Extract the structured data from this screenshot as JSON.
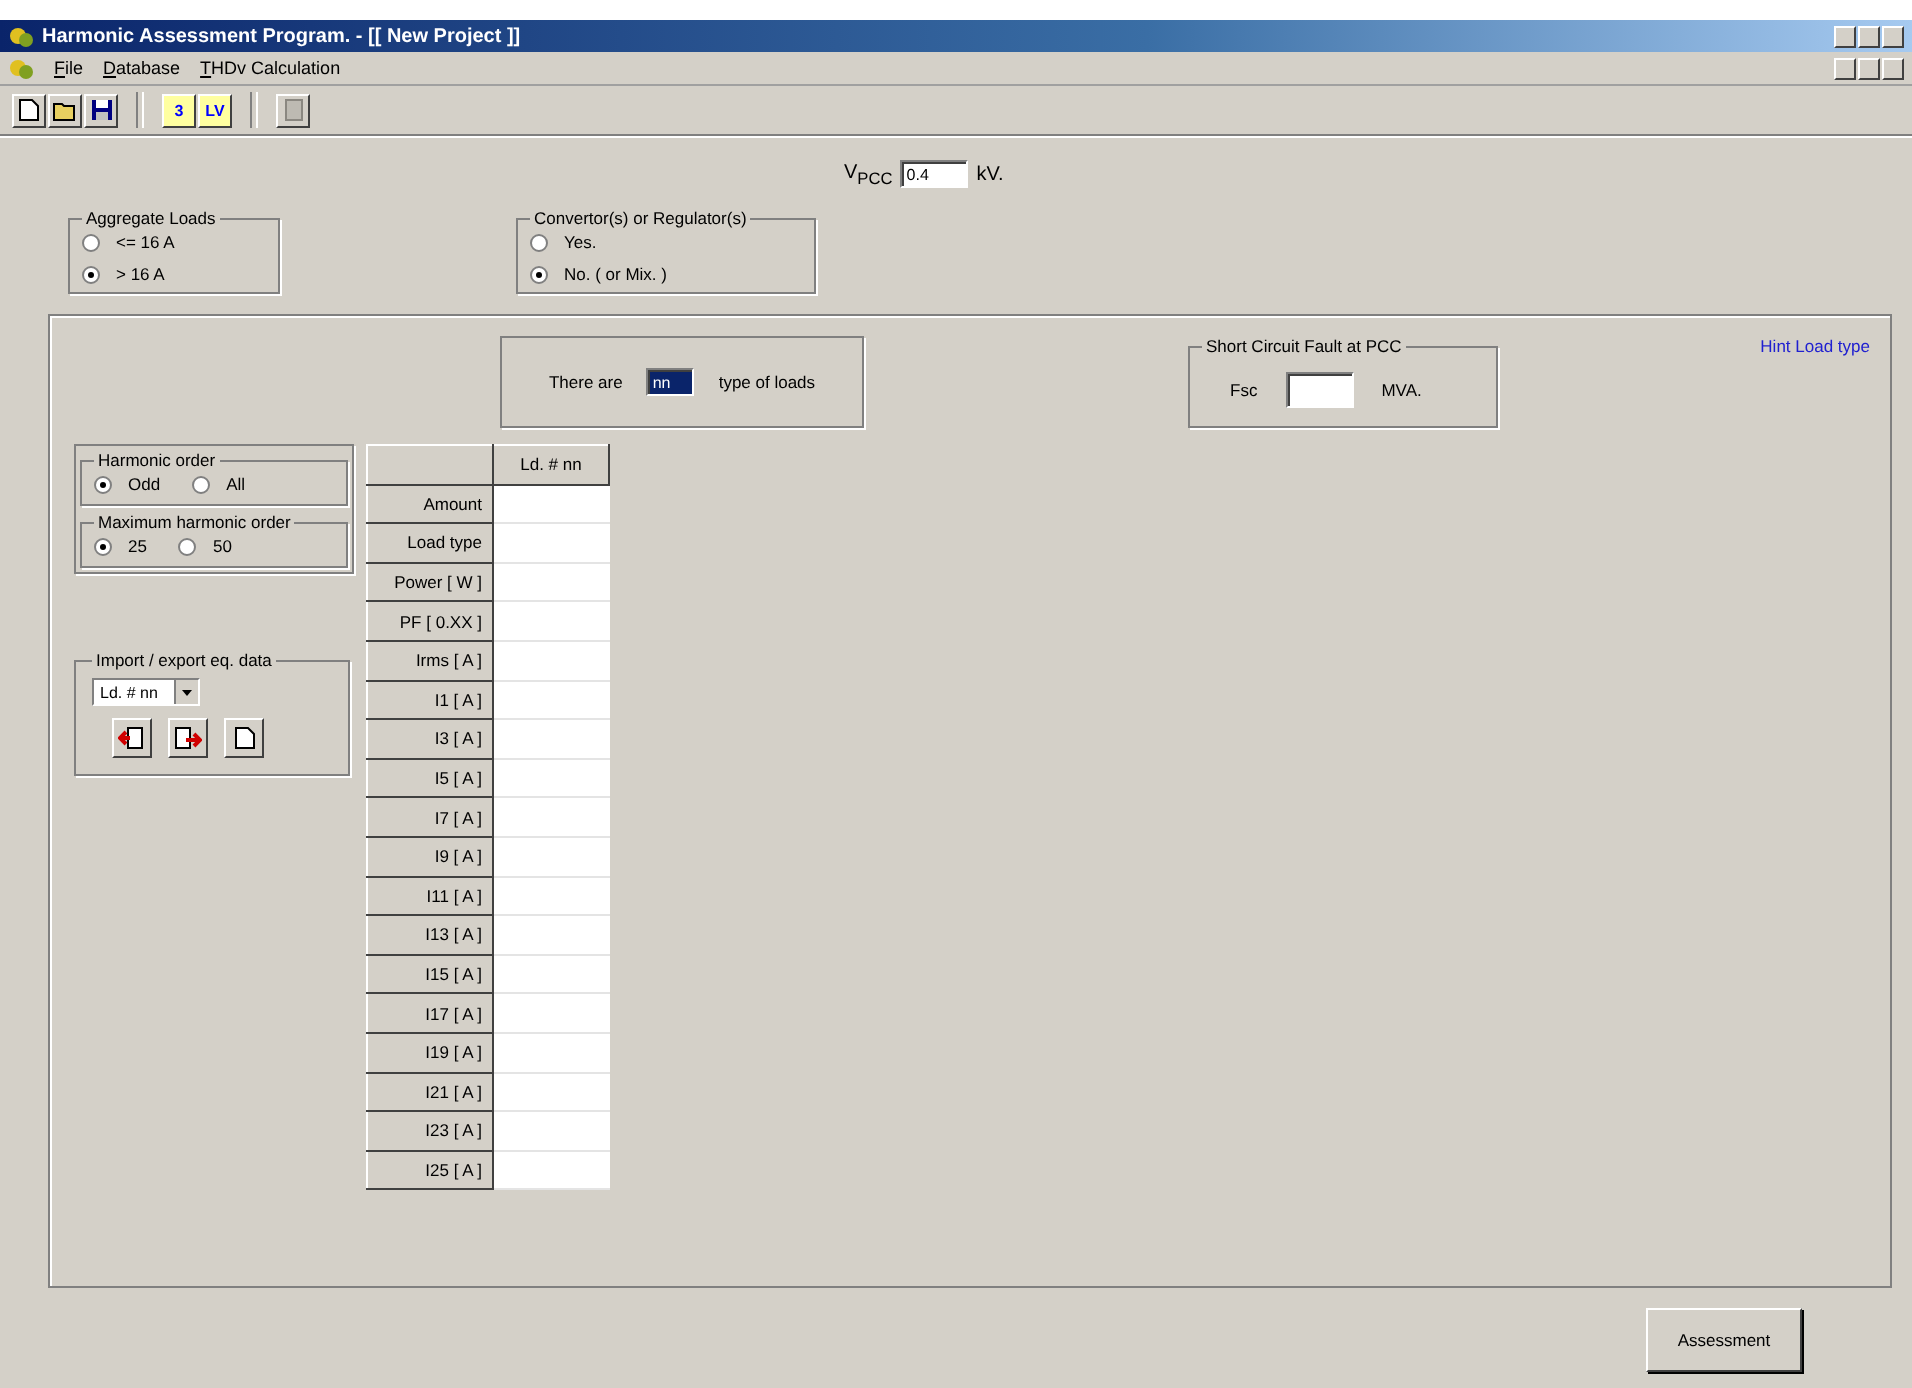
{
  "window": {
    "title": "Harmonic Assessment Program. - [[ New Project ]]"
  },
  "menu": [
    "File",
    "Database",
    "THDv Calculation"
  ],
  "toolbar": [
    {
      "kind": "new"
    },
    {
      "kind": "open"
    },
    {
      "kind": "save"
    },
    {
      "kind": "sep"
    },
    {
      "kind": "text",
      "label": "3"
    },
    {
      "kind": "text",
      "label": "LV"
    },
    {
      "kind": "sep"
    },
    {
      "kind": "print",
      "disabled": true
    }
  ],
  "vpcc": {
    "label": "V$_{PCC}$",
    "value": "0.4",
    "unit": "kV."
  },
  "aggregate_loads": {
    "title": "Aggregate Loads",
    "options": [
      {
        "label": "<= 16 A",
        "selected": false
      },
      {
        "label": "> 16 A",
        "selected": true
      }
    ]
  },
  "converters": {
    "title": "Convertor(s) or Regulator(s)",
    "options": [
      {
        "label": "Yes.",
        "selected": false
      },
      {
        "label": "No. ( or Mix. )",
        "selected": true
      }
    ]
  },
  "load_count": {
    "prefix": "There are",
    "value": "nn",
    "highlighted": true,
    "suffix": "type of loads"
  },
  "short_circuit": {
    "title": "Short Circuit Fault at PCC",
    "label": "Fsc",
    "unit": "MVA."
  },
  "hint_link": "Hint  Load type",
  "harmonic_order": {
    "title": "Harmonic order",
    "options": [
      {
        "label": "Odd",
        "selected": true
      },
      {
        "label": "All",
        "selected": false
      }
    ]
  },
  "max_harmonic_order": {
    "title": "Maximum harmonic order",
    "options": [
      {
        "label": "25",
        "selected": true
      },
      {
        "label": "50",
        "selected": false
      }
    ]
  },
  "import_export": {
    "title": "Import / export eq. data",
    "dropdown": "Ld. # nn",
    "buttons": [
      {
        "kind": "import"
      },
      {
        "kind": "export"
      },
      {
        "kind": "new"
      }
    ]
  },
  "table": {
    "column": "Ld. # nn",
    "rows": [
      "Amount",
      "Load type",
      "Power [ W ]",
      "PF [ 0.XX ]",
      "Irms [ A ]",
      "I1 [ A ]",
      "I3 [ A ]",
      "I5 [ A ]",
      "I7 [ A ]",
      "I9 [ A ]",
      "I11 [ A ]",
      "I13 [ A ]",
      "I15 [ A ]",
      "I17 [ A ]",
      "I19 [ A ]",
      "I21 [ A ]",
      "I23 [ A ]",
      "I25 [ A ]"
    ]
  },
  "assessment_button": "Assessment"
}
